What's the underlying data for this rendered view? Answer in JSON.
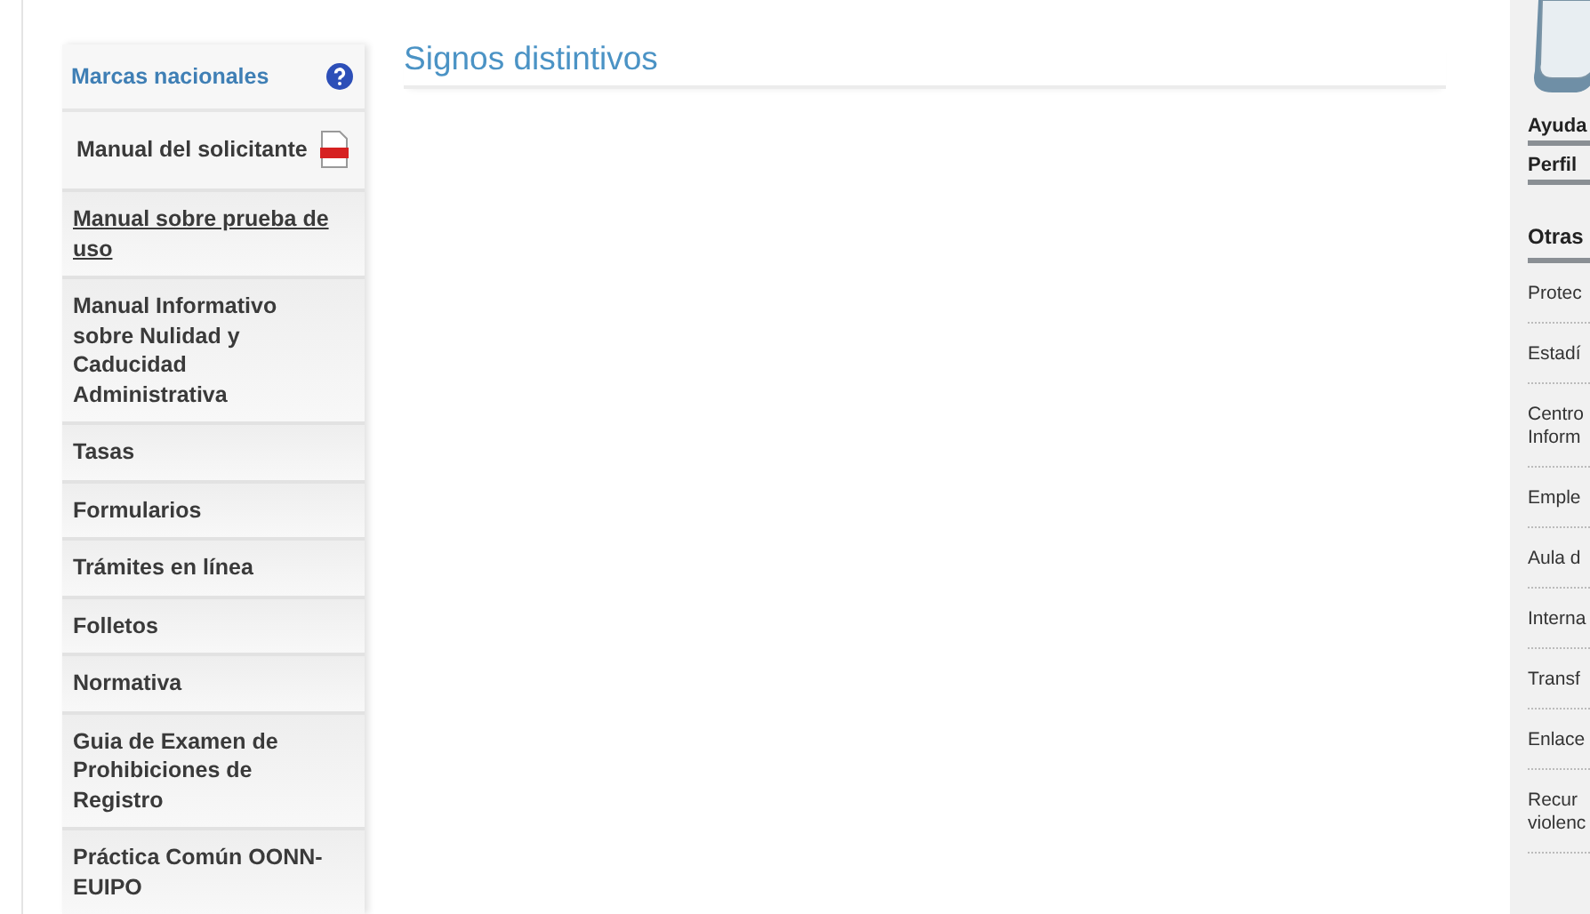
{
  "sidebar": {
    "title": "Marcas nacionales",
    "items": [
      {
        "label": "Manual del solicitante",
        "kind": "pdf"
      },
      {
        "label": "Manual sobre prueba de uso",
        "kind": "link"
      },
      {
        "label": "Manual Informativo sobre Nulidad y Caducidad Administrativa",
        "kind": "plain"
      },
      {
        "label": "Tasas",
        "kind": "plain"
      },
      {
        "label": "Formularios",
        "kind": "plain"
      },
      {
        "label": "Trámites en línea",
        "kind": "plain"
      },
      {
        "label": "Folletos",
        "kind": "plain"
      },
      {
        "label": "Normativa",
        "kind": "plain"
      },
      {
        "label": "Guia de Examen de Prohibiciones de Registro",
        "kind": "plain"
      },
      {
        "label": "Práctica Común OONN-EUIPO",
        "kind": "plain"
      }
    ]
  },
  "main": {
    "title": "Signos distintivos"
  },
  "right_panel": {
    "links": [
      "Ayuda",
      "Perfil"
    ],
    "section_title": "Otras",
    "items": [
      [
        "Protec"
      ],
      [
        "Estadí"
      ],
      [
        "Centro",
        "Inform"
      ],
      [
        "Emple"
      ],
      [
        "Aula d"
      ],
      [
        "Interna"
      ],
      [
        "Transf"
      ],
      [
        "Enlace"
      ],
      [
        "Recur",
        "violenc"
      ]
    ]
  }
}
